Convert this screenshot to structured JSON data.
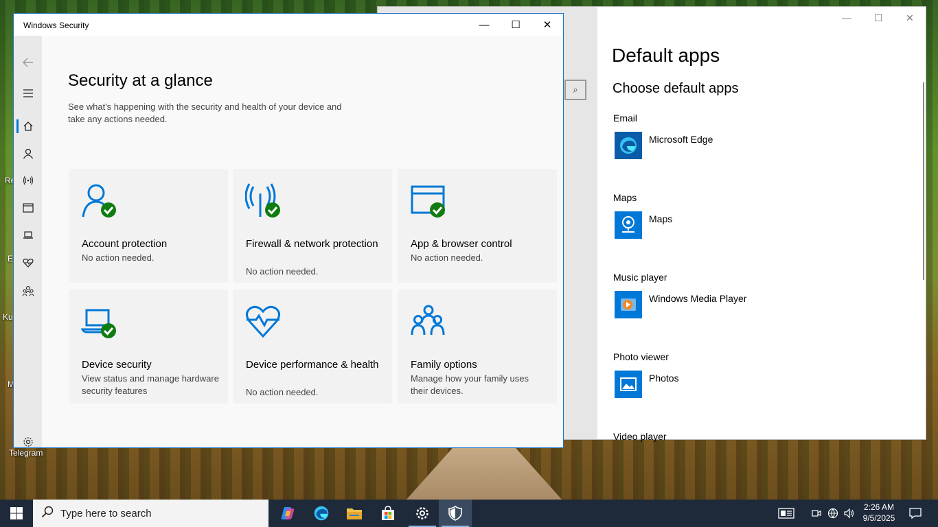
{
  "desktop": {
    "icons": [
      {
        "label": "Re"
      },
      {
        "label": "E"
      },
      {
        "label": "Ku"
      },
      {
        "label": "M"
      },
      {
        "label": "Telegram"
      }
    ]
  },
  "default_apps": {
    "title": "Default apps",
    "subtitle": "Choose default apps",
    "groups": [
      {
        "label": "Email",
        "app": "Microsoft Edge"
      },
      {
        "label": "Maps",
        "app": "Maps"
      },
      {
        "label": "Music player",
        "app": "Windows Media Player"
      },
      {
        "label": "Photo viewer",
        "app": "Photos"
      },
      {
        "label": "Video player",
        "app": ""
      }
    ],
    "window_buttons": {
      "minimize": "—",
      "maximize": "☐",
      "close": "✕"
    }
  },
  "security": {
    "window_title": "Windows Security",
    "window_buttons": {
      "minimize": "—",
      "maximize": "☐",
      "close": "✕"
    },
    "heading": "Security at a glance",
    "description": "See what's happening with the security and health of your device and take any actions needed.",
    "nav": [
      {
        "icon": "back-arrow-icon"
      },
      {
        "icon": "hamburger-menu-icon"
      },
      {
        "icon": "home-icon",
        "active": true
      },
      {
        "icon": "account-icon"
      },
      {
        "icon": "network-icon"
      },
      {
        "icon": "browser-icon"
      },
      {
        "icon": "device-icon"
      },
      {
        "icon": "health-icon"
      },
      {
        "icon": "family-icon"
      },
      {
        "icon": "settings-gear-icon"
      }
    ],
    "tiles": [
      {
        "title": "Account protection",
        "status": "No action needed.",
        "icon": "account-icon",
        "ok": true
      },
      {
        "title": "Firewall & network protection",
        "status": "No action needed.",
        "icon": "network-icon",
        "ok": true
      },
      {
        "title": "App & browser control",
        "status": "No action needed.",
        "icon": "browser-icon",
        "ok": true
      },
      {
        "title": "Device security",
        "status": "View status and manage hardware security features",
        "icon": "laptop-icon",
        "ok": true
      },
      {
        "title": "Device performance & health",
        "status": "No action needed.",
        "icon": "heart-icon",
        "ok": false
      },
      {
        "title": "Family options",
        "status": "Manage how your family uses their devices.",
        "icon": "family-icon",
        "ok": false
      }
    ],
    "colors": {
      "accent": "#0078d7",
      "ok": "#107c10"
    }
  },
  "taskbar": {
    "search_placeholder": "Type here to search",
    "time": "2:26 AM",
    "date": "9/5/2025"
  }
}
